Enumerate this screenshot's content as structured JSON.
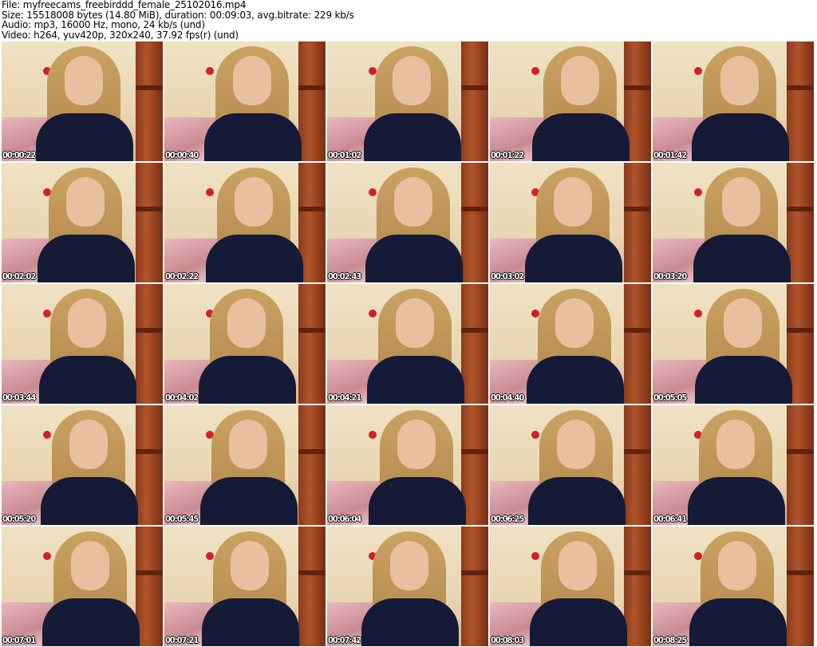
{
  "header": {
    "file": "File: myfreecams_freebirddd_female_25102016.mp4",
    "size": "Size: 15518008 bytes (14.80 MiB), duration: 00:09:03, avg.bitrate: 229 kb/s",
    "audio": "Audio: mp3, 16000 Hz, mono, 24 kb/s (und)",
    "video": "Video: h264, yuv420p, 320x240, 37.92 fps(r) (und)"
  },
  "thumbnails": [
    "00:00:22",
    "00:00:40",
    "00:01:02",
    "00:01:22",
    "00:01:42",
    "00:02:02",
    "00:02:22",
    "00:02:43",
    "00:03:02",
    "00:03:20",
    "00:03:44",
    "00:04:02",
    "00:04:21",
    "00:04:40",
    "00:05:05",
    "00:05:20",
    "00:05:45",
    "00:06:04",
    "00:06:25",
    "00:06:41",
    "00:07:01",
    "00:07:21",
    "00:07:42",
    "00:08:03",
    "00:08:25"
  ]
}
